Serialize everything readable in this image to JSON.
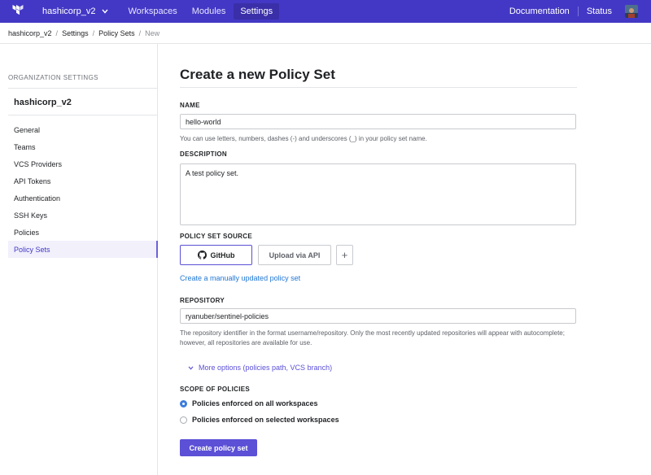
{
  "topbar": {
    "org_name": "hashicorp_v2",
    "nav": [
      "Workspaces",
      "Modules",
      "Settings"
    ],
    "active_nav": "Settings",
    "documentation": "Documentation",
    "status": "Status",
    "brand_color": "#4338c5"
  },
  "breadcrumb": {
    "items": [
      "hashicorp_v2",
      "Settings",
      "Policy Sets"
    ],
    "current": "New"
  },
  "sidebar": {
    "heading": "ORGANIZATION SETTINGS",
    "org": "hashicorp_v2",
    "items": [
      "General",
      "Teams",
      "VCS Providers",
      "API Tokens",
      "Authentication",
      "SSH Keys",
      "Policies",
      "Policy Sets"
    ],
    "active_item": "Policy Sets"
  },
  "form": {
    "title": "Create a new Policy Set",
    "name_label": "NAME",
    "name_value": "hello-world",
    "name_help": "You can use letters, numbers, dashes (-) and underscores (_) in your policy set name.",
    "description_label": "DESCRIPTION",
    "description_value": "A test policy set.",
    "source_label": "POLICY SET SOURCE",
    "source_github": "GitHub",
    "source_api": "Upload via API",
    "source_add": "+",
    "manual_link": "Create a manually updated policy set",
    "repository_label": "REPOSITORY",
    "repository_value": "ryanuber/sentinel-policies",
    "repository_help": "The repository identifier in the format username/repository. Only the most recently updated repositories will appear with autocomplete; however, all repositories are available for use.",
    "more_options": "More options (policies path, VCS branch)",
    "scope_label": "SCOPE OF POLICIES",
    "scope_all": "Policies enforced on all workspaces",
    "scope_selected": "Policies enforced on selected workspaces",
    "scope_checked": "all",
    "submit": "Create policy set",
    "accent_color": "#5b50d6",
    "link_color": "#1f76d4"
  }
}
